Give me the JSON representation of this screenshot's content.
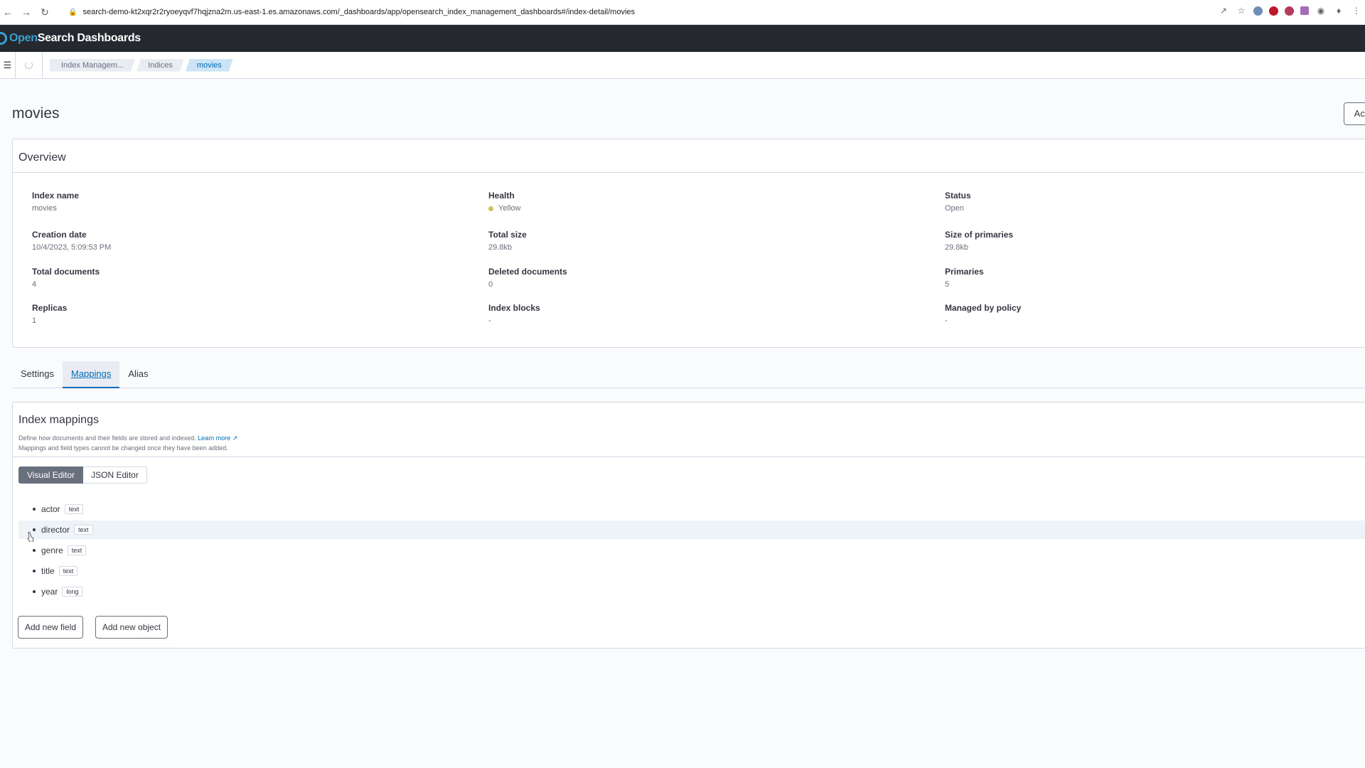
{
  "browser": {
    "url": "search-demo-kt2xqr2r2ryoeyqvf7hqjzna2m.us-east-1.es.amazonaws.com/_dashboards/app/opensearch_index_management_dashboards#/index-detail/movies"
  },
  "app": {
    "logo_open": "Open",
    "logo_rest": "Search Dashboards"
  },
  "breadcrumbs": [
    {
      "label": "Index Managem..."
    },
    {
      "label": "Indices"
    },
    {
      "label": "movies"
    }
  ],
  "page": {
    "title": "movies",
    "actions_label": "Actions"
  },
  "overview": {
    "title": "Overview",
    "items": [
      {
        "label": "Index name",
        "value": "movies"
      },
      {
        "label": "Health",
        "value": "Yellow"
      },
      {
        "label": "Status",
        "value": "Open"
      },
      {
        "label": "Creation date",
        "value": "10/4/2023, 5:09:53 PM"
      },
      {
        "label": "Total size",
        "value": "29.8kb"
      },
      {
        "label": "Size of primaries",
        "value": "29.8kb"
      },
      {
        "label": "Total documents",
        "value": "4"
      },
      {
        "label": "Deleted documents",
        "value": "0"
      },
      {
        "label": "Primaries",
        "value": "5"
      },
      {
        "label": "Replicas",
        "value": "1"
      },
      {
        "label": "Index blocks",
        "value": "-"
      },
      {
        "label": "Managed by policy",
        "value": "-"
      }
    ],
    "health_color": "#d6bf57"
  },
  "tabs": [
    {
      "label": "Settings"
    },
    {
      "label": "Mappings"
    },
    {
      "label": "Alias"
    }
  ],
  "active_tab": "Mappings",
  "mappings": {
    "title": "Index mappings",
    "desc_line1": "Define how documents and their fields are stored and indexed.",
    "learn_more": "Learn more",
    "desc_line2": "Mappings and field types cannot be changed once they have been added.",
    "visual_editor": "Visual Editor",
    "json_editor": "JSON Editor",
    "fields": [
      {
        "name": "actor",
        "type": "text"
      },
      {
        "name": "director",
        "type": "text"
      },
      {
        "name": "genre",
        "type": "text"
      },
      {
        "name": "title",
        "type": "text"
      },
      {
        "name": "year",
        "type": "long"
      }
    ],
    "add_field": "Add new field",
    "add_object": "Add new object"
  },
  "colors": {
    "header_bg": "#25282f",
    "accent": "#006bb8",
    "logo_accent": "#35a2d3"
  }
}
